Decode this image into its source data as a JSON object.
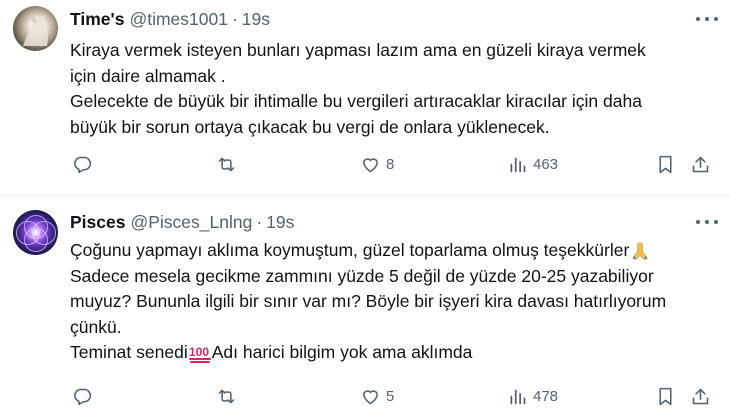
{
  "tweets": [
    {
      "name": "Time's",
      "handle": "@times1001",
      "separator": "·",
      "time": "19s",
      "lines": [
        "Kiraya vermek isteyen bunları yapması lazım ama en güzeli kiraya vermek",
        "için daire almamak .",
        "Gelecekte de büyük bir ihtimalle bu vergileri artıracaklar kiracılar için daha",
        "büyük bir sorun ortaya çıkacak bu vergi de onlara yüklenecek."
      ],
      "stats": {
        "replies": "",
        "reposts": "",
        "likes": "8",
        "views": "463"
      }
    },
    {
      "name": "Pisces",
      "handle": "@Pisces_Lnlng",
      "separator": "·",
      "time": "19s",
      "lines": [
        "Çoğunu yapmayı aklıma koymuştum, güzel toparlama olmuş teşekkürler",
        "Sadece mesela gecikme zammını yüzde 5 değil de yüzde 20-25 yazabiliyor",
        "muyuz? Bununla ilgili bir sınır var mı? Böyle bir işyeri kira davası hatırlıyorum",
        "çünkü.",
        "Teminat senedi",
        "Adı harici bilgim yok ama aklımda"
      ],
      "stats": {
        "replies": "",
        "reposts": "",
        "likes": "5",
        "views": "478"
      }
    }
  ],
  "icons": {
    "reply": "reply-icon",
    "repost": "repost-icon",
    "like": "heart-icon",
    "views": "views-icon",
    "bookmark": "bookmark-icon",
    "share": "share-icon",
    "more": "more-icon",
    "praying_hands": "praying-hands-emoji",
    "hundred": "hundred-points-emoji"
  },
  "colors": {
    "text": "#0f1419",
    "secondary": "#536471",
    "divider": "#eff3f4",
    "hundred": "#e0245e"
  }
}
